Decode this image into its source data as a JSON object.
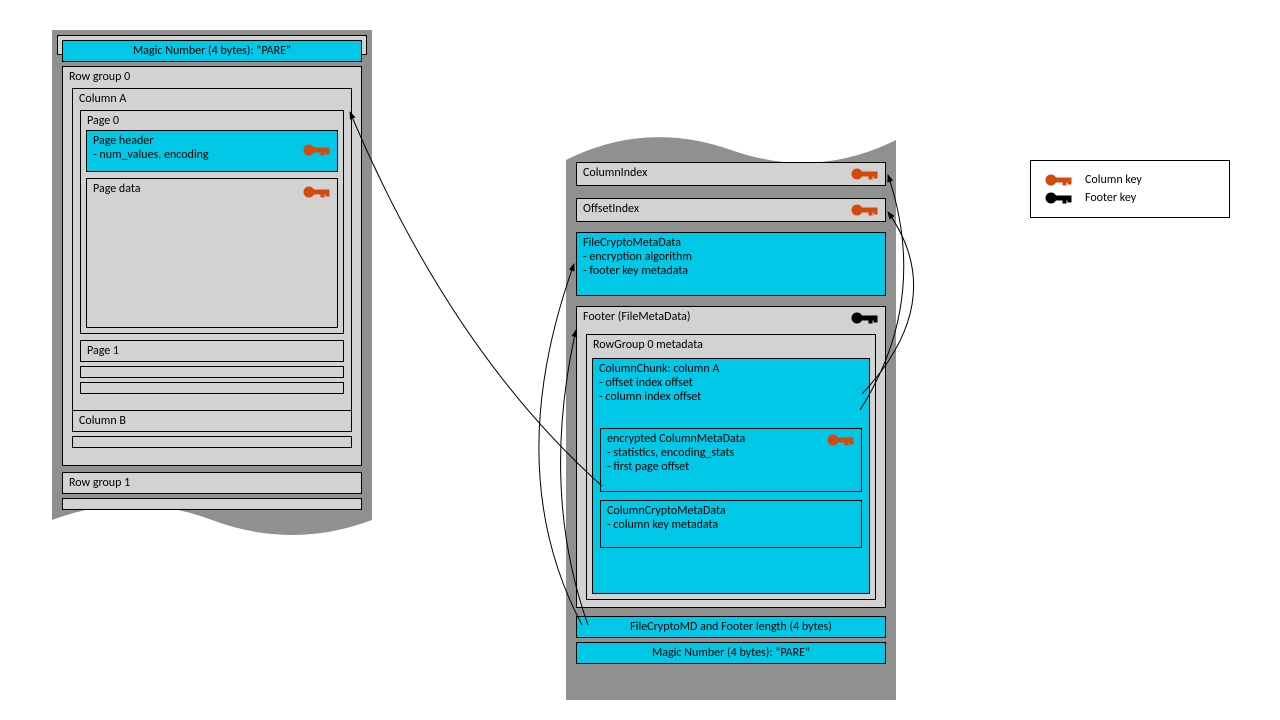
{
  "left": {
    "magic": "Magic Number (4 bytes): “PARE”",
    "rg0": "Row group 0",
    "colA": "Column A",
    "page0": "Page 0",
    "pageHeader1": "Page header",
    "pageHeader2": "- num_values, encoding",
    "pageData": "Page data",
    "page1": "Page 1",
    "colB": "Column  B",
    "rg1": "Row group  1"
  },
  "right": {
    "colIndex": "ColumnIndex",
    "offIndex": "OffsetIndex",
    "crypto1": "FileCryptoMetaData",
    "crypto2": "-   encryption algorithm",
    "crypto3": "-   footer key metadata",
    "footer": "Footer (FileMetaData)",
    "rg0meta": "RowGroup 0 metadata",
    "chunk1": "ColumnChunk: column A",
    "chunk2": "-   offset index offset",
    "chunk3": "-   column index offset",
    "enc1": "encrypted ColumnMetaData",
    "enc2": "-   statistics, encoding_stats",
    "enc3": "-   first page offset",
    "ccmd1": "ColumnCryptoMetaData",
    "ccmd2": "- column key metadata",
    "len": "FileCryptoMD and Footer length (4 bytes)",
    "magic": "Magic Number (4 bytes): “PARE”"
  },
  "legend": {
    "col": "Column key",
    "foot": "Footer key"
  }
}
